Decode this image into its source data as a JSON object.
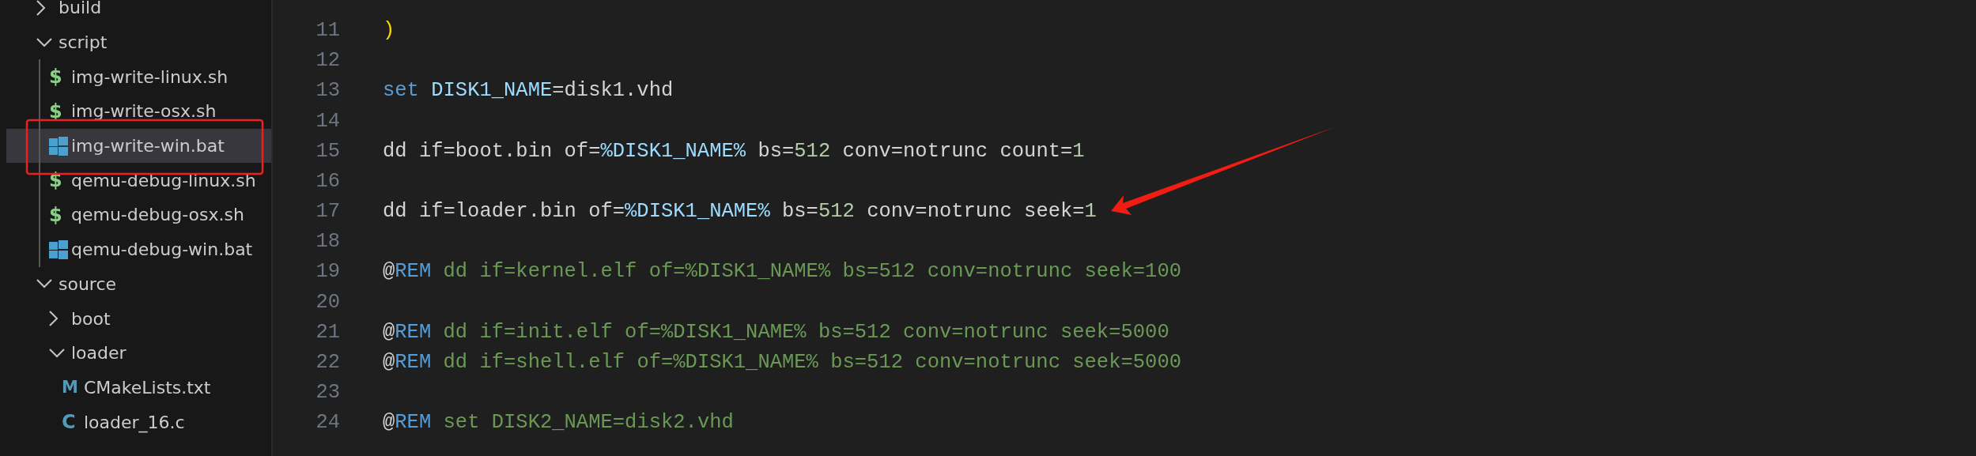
{
  "explorer": {
    "items": [
      {
        "kind": "folder",
        "label": "build",
        "expanded": false,
        "selected": false
      },
      {
        "kind": "folder",
        "label": "script",
        "expanded": true,
        "selected": false,
        "children": [
          {
            "kind": "shell",
            "glyph": "$",
            "label": "img-write-linux.sh",
            "selected": false
          },
          {
            "kind": "shell",
            "glyph": "$",
            "label": "img-write-osx.sh",
            "selected": false
          },
          {
            "kind": "windows",
            "label": "img-write-win.bat",
            "selected": true
          },
          {
            "kind": "shell",
            "glyph": "$",
            "label": "qemu-debug-linux.sh",
            "selected": false
          },
          {
            "kind": "shell",
            "glyph": "$",
            "label": "qemu-debug-osx.sh",
            "selected": false
          },
          {
            "kind": "windows",
            "label": "qemu-debug-win.bat",
            "selected": false
          }
        ]
      },
      {
        "kind": "folder",
        "label": "source",
        "expanded": true,
        "selected": false,
        "children": [
          {
            "kind": "folder",
            "label": "boot",
            "expanded": false,
            "selected": false
          },
          {
            "kind": "folder",
            "label": "loader",
            "expanded": true,
            "selected": false,
            "children": [
              {
                "kind": "cmake",
                "glyph": "M",
                "label": "CMakeLists.txt",
                "selected": false
              },
              {
                "kind": "c",
                "glyph": "C",
                "label": "loader_16.c",
                "selected": false
              }
            ]
          }
        ]
      }
    ]
  },
  "editor": {
    "lines": [
      {
        "number": "11",
        "tokens": [
          {
            "kind": "bracket",
            "text": ")"
          }
        ]
      },
      {
        "number": "12"
      },
      {
        "number": "13",
        "tokens": [
          {
            "kind": "keyword",
            "text": "set "
          },
          {
            "kind": "variable",
            "text": "DISK1_NAME"
          },
          {
            "kind": "plain",
            "text": "=disk1.vhd"
          }
        ]
      },
      {
        "number": "14"
      },
      {
        "number": "15",
        "tokens": [
          {
            "kind": "plain",
            "text": "dd if=boot.bin of="
          },
          {
            "kind": "variable",
            "text": "%DISK1_NAME%"
          },
          {
            "kind": "plain",
            "text": " bs="
          },
          {
            "kind": "number",
            "text": "512"
          },
          {
            "kind": "plain",
            "text": " conv=notrunc count="
          },
          {
            "kind": "number",
            "text": "1"
          }
        ]
      },
      {
        "number": "16"
      },
      {
        "number": "17",
        "tokens": [
          {
            "kind": "plain",
            "text": "dd if=loader.bin of="
          },
          {
            "kind": "variable",
            "text": "%DISK1_NAME%"
          },
          {
            "kind": "plain",
            "text": " bs="
          },
          {
            "kind": "number",
            "text": "512"
          },
          {
            "kind": "plain",
            "text": " conv=notrunc seek="
          },
          {
            "kind": "number",
            "text": "1"
          }
        ]
      },
      {
        "number": "18"
      },
      {
        "number": "19",
        "tokens": [
          {
            "kind": "plain",
            "text": "@"
          },
          {
            "kind": "keyword",
            "text": "REM"
          },
          {
            "kind": "comment",
            "text": " dd if=kernel.elf of=%DISK1_NAME% bs=512 conv=notrunc seek=100"
          }
        ]
      },
      {
        "number": "20"
      },
      {
        "number": "21",
        "tokens": [
          {
            "kind": "plain",
            "text": "@"
          },
          {
            "kind": "keyword",
            "text": "REM"
          },
          {
            "kind": "comment",
            "text": " dd if=init.elf of=%DISK1_NAME% bs=512 conv=notrunc seek=5000"
          }
        ]
      },
      {
        "number": "22",
        "tokens": [
          {
            "kind": "plain",
            "text": "@"
          },
          {
            "kind": "keyword",
            "text": "REM"
          },
          {
            "kind": "comment",
            "text": " dd if=shell.elf of=%DISK1_NAME% bs=512 conv=notrunc seek=5000"
          }
        ]
      },
      {
        "number": "23"
      },
      {
        "number": "24",
        "tokens": [
          {
            "kind": "plain",
            "text": "@"
          },
          {
            "kind": "keyword",
            "text": "REM"
          },
          {
            "kind": "comment",
            "text": " set DISK2_NAME=disk2.vhd"
          }
        ]
      }
    ]
  }
}
